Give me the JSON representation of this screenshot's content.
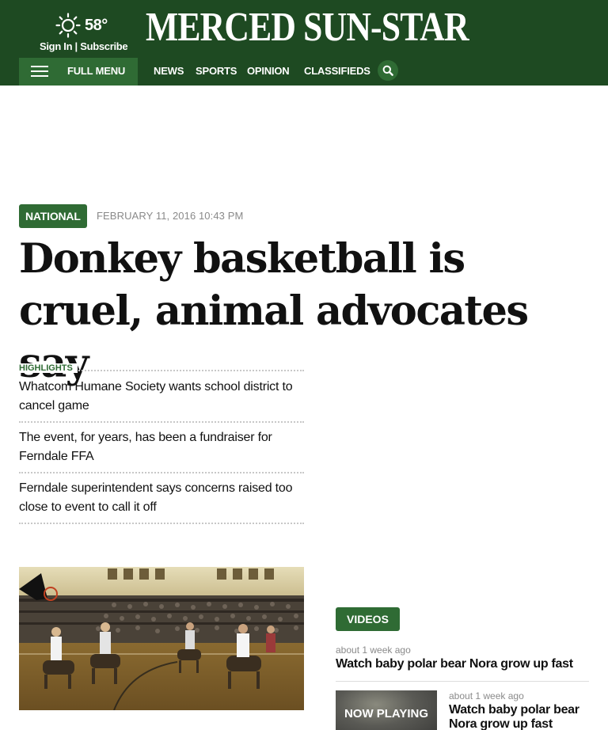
{
  "header": {
    "temperature": "58°",
    "sign_in": "Sign In",
    "separator": "|",
    "subscribe": "Subscribe",
    "logo": "MERCED SUN-STAR",
    "full_menu": "FULL MENU",
    "nav": [
      "NEWS",
      "SPORTS",
      "OPINION",
      "CLASSIFIEDS"
    ],
    "weather_icon": "sun-icon",
    "search_icon": "search-icon"
  },
  "article": {
    "category": "NATIONAL",
    "date": "FEBRUARY 11, 2016 10:43 PM",
    "headline": "Donkey basketball is cruel, animal advocates say"
  },
  "highlights": {
    "label": "HIGHLIGHTS",
    "items": [
      "Whatcom Humane Society wants school district to cancel game",
      "The event, for years, has been a fundraiser for Ferndale FFA",
      "Ferndale superintendent says concerns raised too close to event to call it off"
    ]
  },
  "videos": {
    "label": "VIDEOS",
    "items": [
      {
        "time": "about 1 week ago",
        "title": "Watch baby polar bear Nora grow up fast"
      },
      {
        "time": "about 1 week ago",
        "title": "Watch baby polar bear Nora grow up fast",
        "thumb_overlay": "NOW PLAYING"
      }
    ]
  },
  "colors": {
    "header_bg": "#1e4a22",
    "accent_green": "#2f6b34",
    "meta_gray": "#8a8a8a"
  }
}
